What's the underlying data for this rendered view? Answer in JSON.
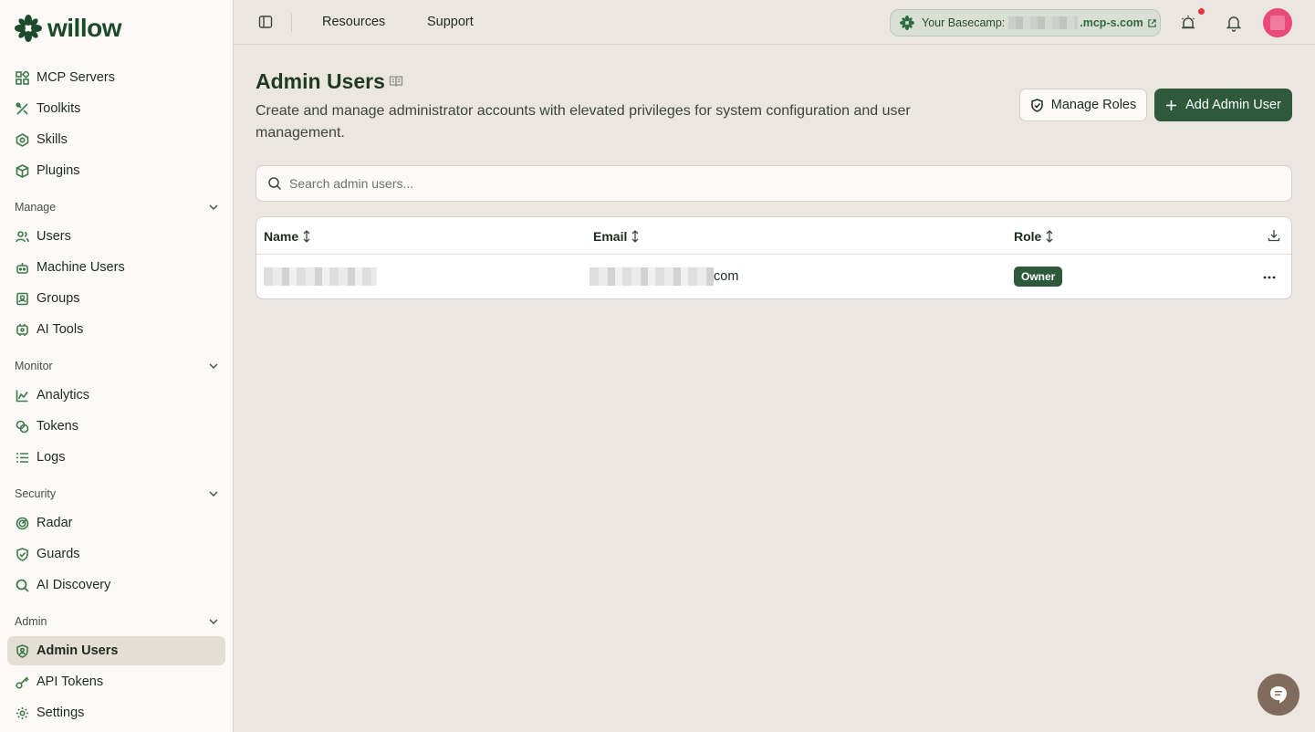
{
  "brand": {
    "name": "willow"
  },
  "sidebar": {
    "top_items": [
      {
        "label": "MCP Servers",
        "icon": "mcp-servers-icon"
      },
      {
        "label": "Toolkits",
        "icon": "toolkits-icon"
      },
      {
        "label": "Skills",
        "icon": "skills-icon"
      },
      {
        "label": "Plugins",
        "icon": "plugins-icon"
      }
    ],
    "sections": [
      {
        "title": "Manage",
        "items": [
          {
            "label": "Users",
            "icon": "users-icon"
          },
          {
            "label": "Machine Users",
            "icon": "robot-icon"
          },
          {
            "label": "Groups",
            "icon": "groups-icon"
          },
          {
            "label": "AI Tools",
            "icon": "ai-tools-icon"
          }
        ]
      },
      {
        "title": "Monitor",
        "items": [
          {
            "label": "Analytics",
            "icon": "analytics-icon"
          },
          {
            "label": "Tokens",
            "icon": "tokens-icon"
          },
          {
            "label": "Logs",
            "icon": "logs-icon"
          }
        ]
      },
      {
        "title": "Security",
        "items": [
          {
            "label": "Radar",
            "icon": "radar-icon"
          },
          {
            "label": "Guards",
            "icon": "shield-check-icon"
          },
          {
            "label": "AI Discovery",
            "icon": "search-icon"
          }
        ]
      },
      {
        "title": "Admin",
        "items": [
          {
            "label": "Admin Users",
            "icon": "admin-shield-icon",
            "active": true
          },
          {
            "label": "API Tokens",
            "icon": "key-icon"
          },
          {
            "label": "Settings",
            "icon": "gear-icon"
          }
        ]
      }
    ]
  },
  "topbar": {
    "links": [
      "Resources",
      "Support"
    ],
    "basecamp_label": "Your Basecamp:",
    "basecamp_domain": ".mcp-s.com",
    "notification_dot": true
  },
  "main": {
    "title": "Admin Users",
    "description": "Create and manage administrator accounts with elevated privileges for system configuration and user management.",
    "manage_roles_label": "Manage Roles",
    "add_admin_label": "Add Admin User",
    "search_placeholder": "Search admin users...",
    "table": {
      "columns": [
        "Name",
        "Email",
        "Role"
      ],
      "rows": [
        {
          "name": "",
          "email_suffix": "com",
          "role": "Owner"
        }
      ]
    }
  },
  "colors": {
    "brand_green": "#2e5a3b",
    "icon_green": "#3f7a4a",
    "background": "#ebe6df",
    "sidebar_bg": "#faf9f7",
    "alert_red": "#e5333f",
    "avatar_pink": "#e8497a",
    "chat_button": "#806b5c"
  }
}
